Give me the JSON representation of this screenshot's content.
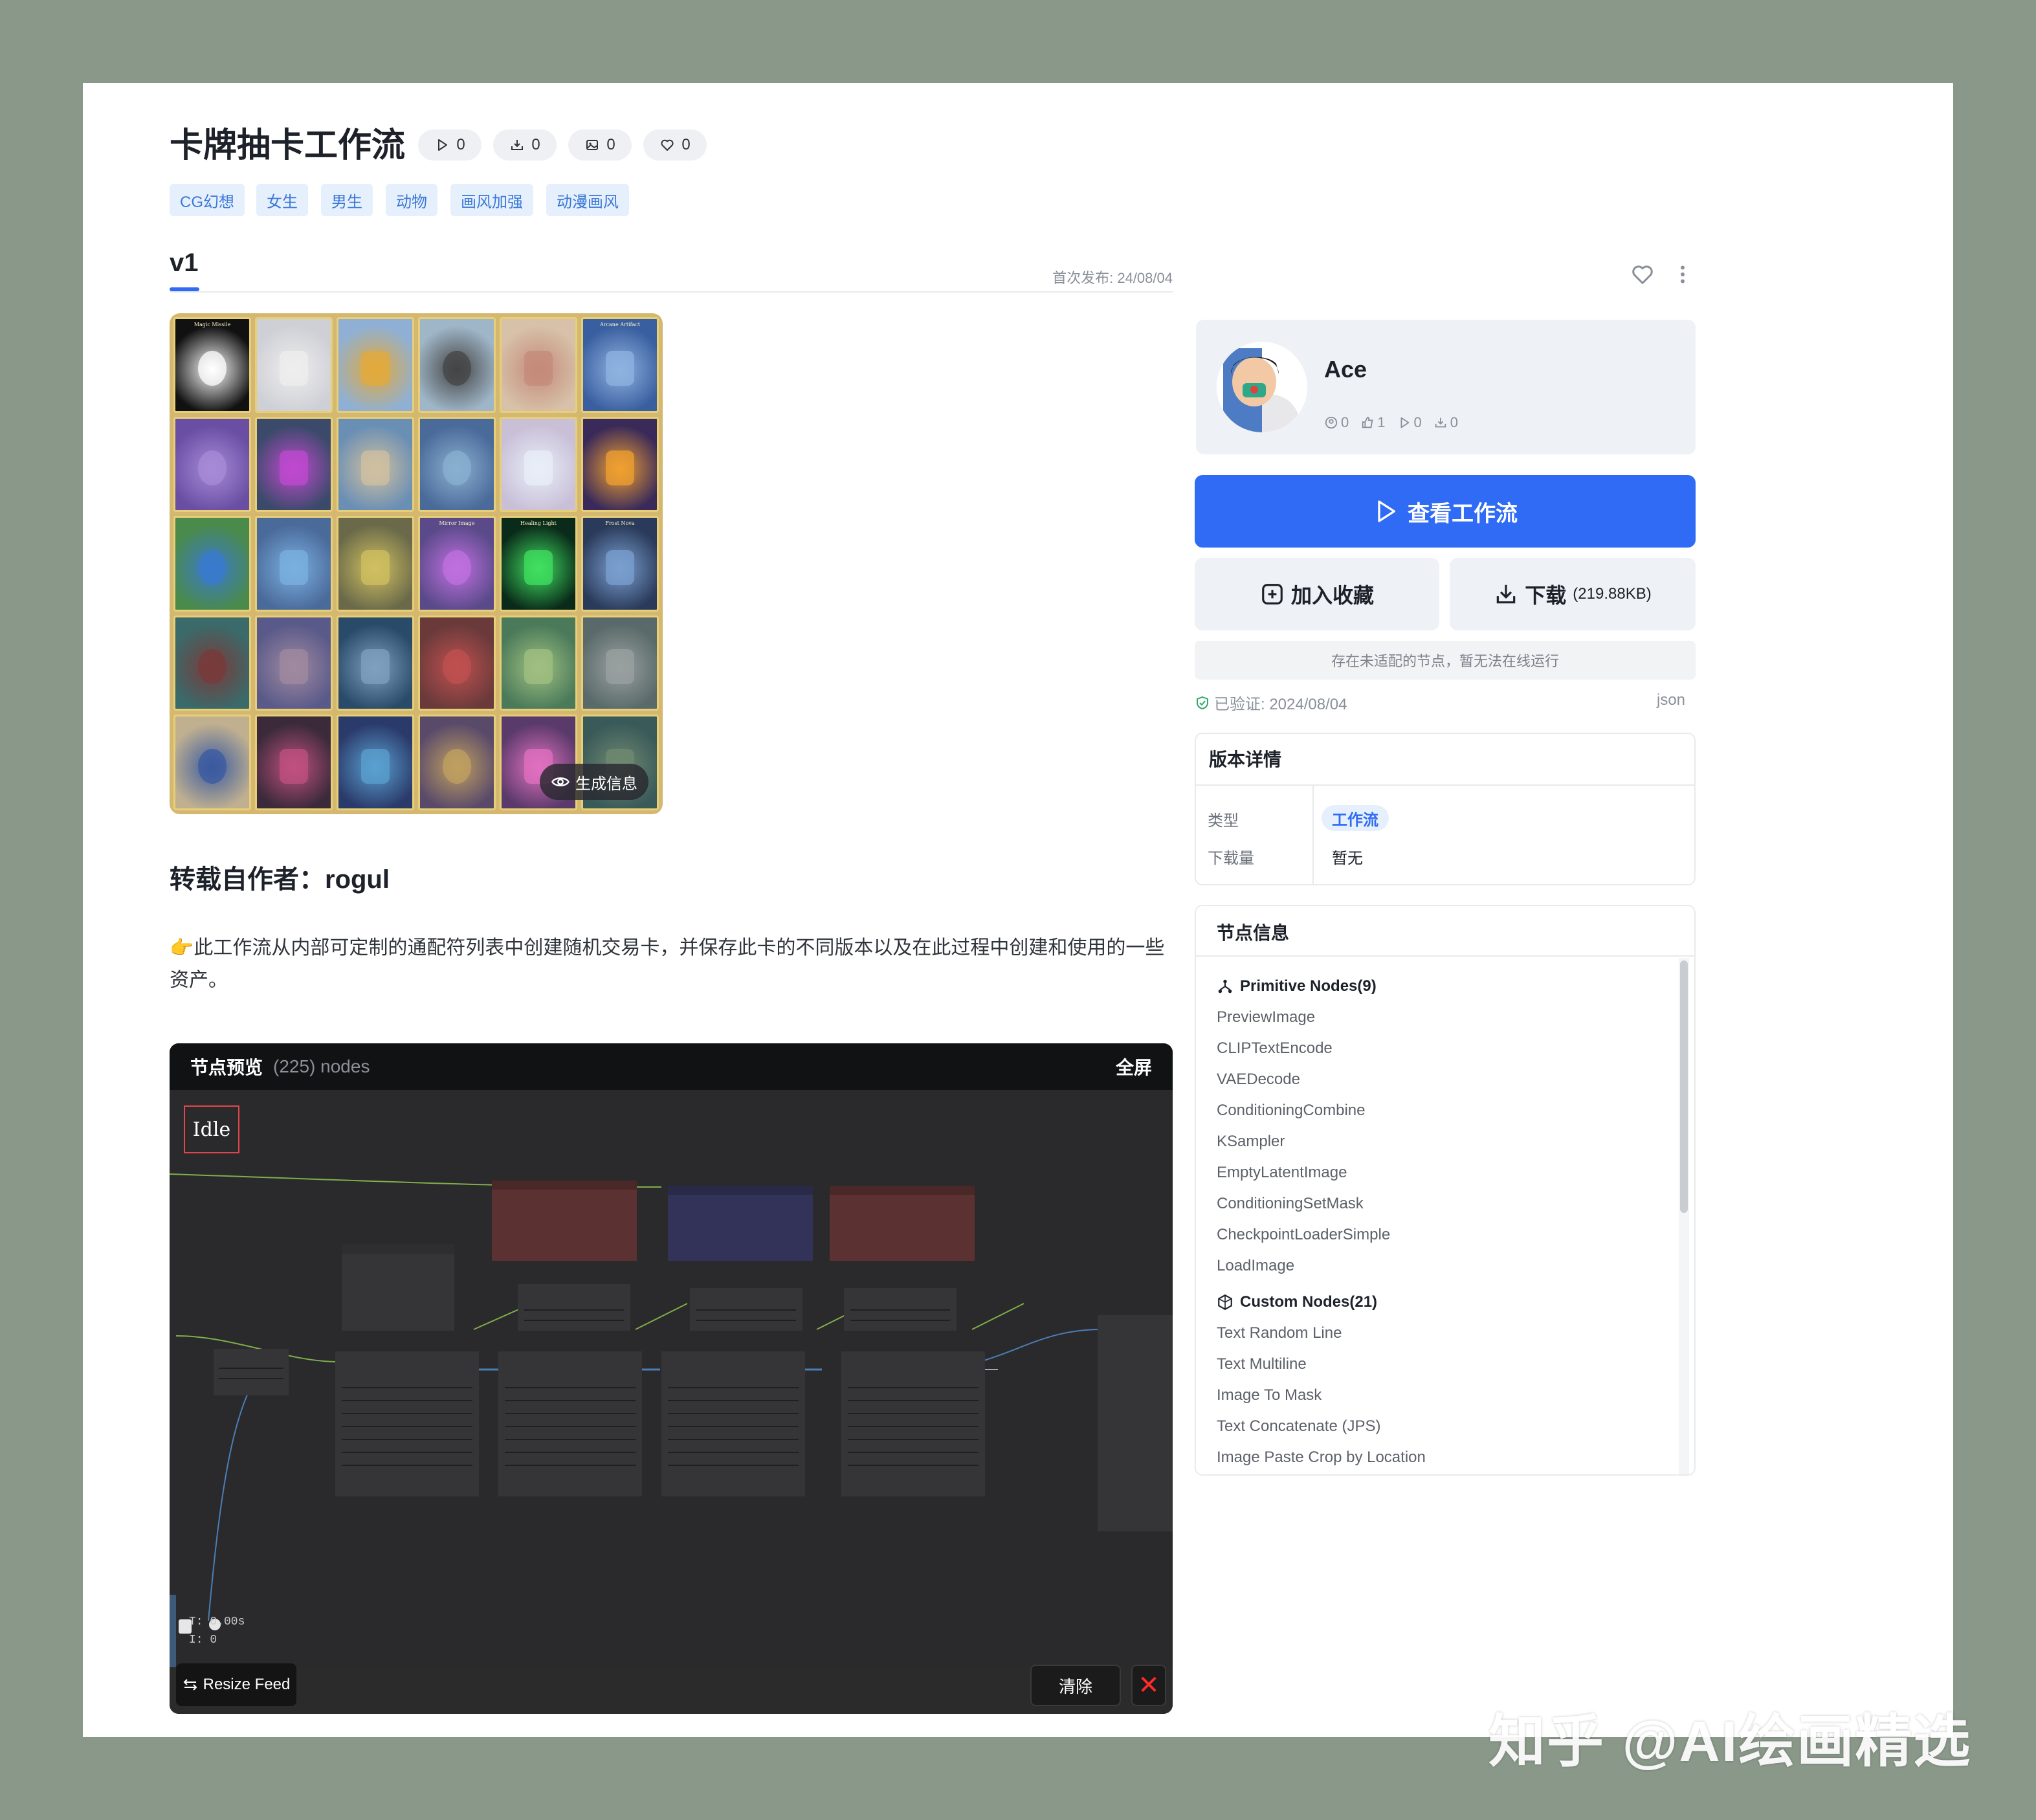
{
  "header": {
    "title": "卡牌抽卡工作流",
    "stats": [
      {
        "icon": "play-icon",
        "value": "0"
      },
      {
        "icon": "download-icon",
        "value": "0"
      },
      {
        "icon": "image-icon",
        "value": "0"
      },
      {
        "icon": "heart-icon",
        "value": "0"
      }
    ],
    "tags": [
      "CG幻想",
      "女生",
      "男生",
      "动物",
      "画风加强",
      "动漫画风"
    ]
  },
  "version": {
    "label": "v1",
    "first_publish": "首次发布: 24/08/04"
  },
  "gallery": {
    "card_titles": [
      "Magic Missile",
      "",
      "",
      "",
      "",
      "Arcane Artifact",
      "",
      "",
      "",
      "",
      "",
      "",
      "",
      "",
      "",
      "Mirror Image",
      "Healing Light",
      "Frost Nova",
      "",
      "",
      "",
      "",
      "",
      "",
      "",
      "",
      "",
      "",
      "",
      ""
    ],
    "generate_info_label": "生成信息"
  },
  "content": {
    "author_line": "转载自作者：rogul",
    "description": "👉此工作流从内部可定制的通配符列表中创建随机交易卡，并保存此卡的不同版本以及在此过程中创建和使用的一些资产。"
  },
  "node_preview": {
    "title": "节点预览",
    "count": "(225) nodes",
    "fullscreen": "全屏",
    "status": "Idle",
    "timing": [
      "T: 0.00s",
      "I: 0"
    ],
    "resize_feed": "Resize Feed",
    "clear": "清除",
    "close": "✕"
  },
  "user": {
    "name": "Ace",
    "stats": [
      {
        "icon": "user-icon",
        "value": "0"
      },
      {
        "icon": "thumb-icon",
        "value": "1"
      },
      {
        "icon": "play-icon",
        "value": "0"
      },
      {
        "icon": "download-icon",
        "value": "0"
      }
    ]
  },
  "actions": {
    "view_workflow": "查看工作流",
    "add_favorite": "加入收藏",
    "download": "下载",
    "download_size": "(219.88KB)",
    "notice": "存在未适配的节点，暂无法在线运行",
    "verified": "已验证: 2024/08/04",
    "format": "json"
  },
  "version_details": {
    "title": "版本详情",
    "type_key": "类型",
    "type_value": "工作流",
    "downloads_key": "下载量",
    "downloads_value": "暂无"
  },
  "node_info": {
    "title": "节点信息",
    "primary_group": "Primitive Nodes(9)",
    "primary_nodes": [
      "PreviewImage",
      "CLIPTextEncode",
      "VAEDecode",
      "ConditioningCombine",
      "KSampler",
      "EmptyLatentImage",
      "ConditioningSetMask",
      "CheckpointLoaderSimple",
      "LoadImage"
    ],
    "custom_group": "Custom Nodes(21)",
    "custom_nodes": [
      "Text Random Line",
      "Text Multiline",
      "Image To Mask",
      "Text Concatenate (JPS)",
      "Image Paste Crop by Location"
    ]
  },
  "watermark": "知乎 @AI绘画精选",
  "colors": {
    "primary": "#2f6bf5",
    "page_bg": "#8a988a",
    "canvas_bg": "#2a2a2c",
    "node_red": "#5b3131",
    "node_blue": "#33335a"
  }
}
